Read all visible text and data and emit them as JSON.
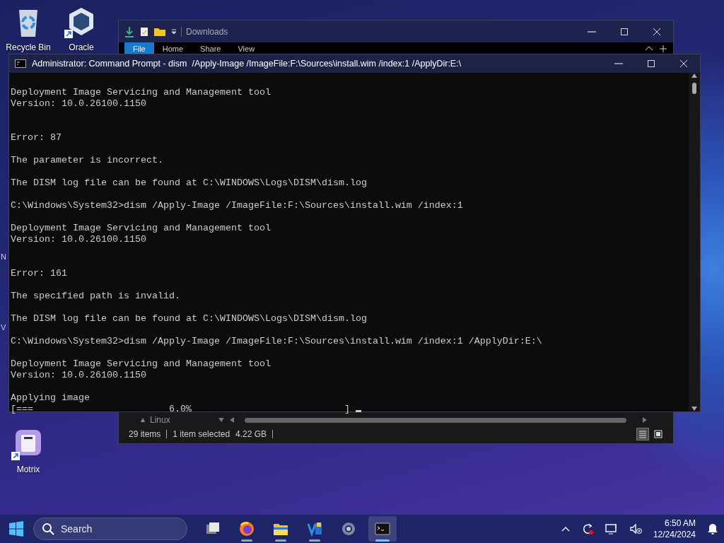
{
  "desktop_icons": [
    {
      "kind": "recycle-bin",
      "label": "Recycle Bin",
      "shortcut": false
    },
    {
      "kind": "cube",
      "label": "Oracle",
      "shortcut": true
    },
    {
      "kind": "download-app",
      "label": "Motrix",
      "shortcut": true
    }
  ],
  "edge_letters": [
    "N",
    "V"
  ],
  "explorer": {
    "title": "Downloads",
    "ribbon_tabs": [
      {
        "label": "File",
        "selected": true
      },
      {
        "label": "Home",
        "selected": false
      },
      {
        "label": "Share",
        "selected": false
      },
      {
        "label": "View",
        "selected": false
      }
    ],
    "nav_item": "Linux",
    "status": {
      "items": "29 items",
      "selection": "1 item selected",
      "size": "4.22 GB"
    },
    "views": [
      {
        "kind": "details",
        "selected": true
      },
      {
        "kind": "tiles",
        "selected": false
      }
    ]
  },
  "cmd": {
    "title": "Administrator: Command Prompt - dism  /Apply-Image /ImageFile:F:\\Sources\\install.wim /index:1 /ApplyDir:E:\\",
    "console_text": "Deployment Image Servicing and Management tool\nVersion: 10.0.26100.1150\n\n\nError: 87\n\nThe parameter is incorrect.\n\nThe DISM log file can be found at C:\\WINDOWS\\Logs\\DISM\\dism.log\n\nC:\\Windows\\System32>dism /Apply-Image /ImageFile:F:\\Sources\\install.wim /index:1\n\nDeployment Image Servicing and Management tool\nVersion: 10.0.26100.1150\n\n\nError: 161\n\nThe specified path is invalid.\n\nThe DISM log file can be found at C:\\WINDOWS\\Logs\\DISM\\dism.log\n\nC:\\Windows\\System32>dism /Apply-Image /ImageFile:F:\\Sources\\install.wim /index:1 /ApplyDir:E:\\\n\nDeployment Image Servicing and Management tool\nVersion: 10.0.26100.1150\n\nApplying image\n[===                        6.0%                           ]"
  },
  "taskbar": {
    "search": {
      "placeholder": "Search"
    },
    "apps": [
      {
        "kind": "task-view",
        "running": false,
        "selected": false
      },
      {
        "kind": "firefox",
        "running": true,
        "selected": false
      },
      {
        "kind": "folder",
        "running": true,
        "selected": false
      },
      {
        "kind": "vbox",
        "running": true,
        "selected": false
      },
      {
        "kind": "settings",
        "running": false,
        "selected": false
      },
      {
        "kind": "terminal",
        "running": true,
        "selected": true
      }
    ],
    "time": "6:50 AM",
    "date": "12/24/2024"
  }
}
